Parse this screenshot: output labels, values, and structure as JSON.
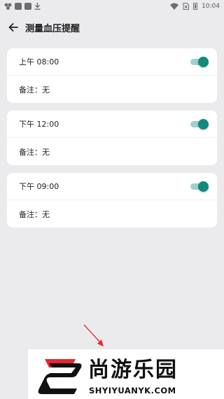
{
  "status_bar": {
    "time": "10:04",
    "icons": [
      "notification-dots-icon",
      "app-square-icon",
      "app-square-icon",
      "download-icon",
      "wifi-icon",
      "no-sim-icon",
      "battery-icon"
    ]
  },
  "app_bar": {
    "title": "测量血压提醒",
    "back_icon": "arrow-left-icon"
  },
  "reminders": [
    {
      "time_label": "上午 08:00",
      "note": "备注：无",
      "enabled": true
    },
    {
      "time_label": "下午 12:00",
      "note": "备注：无",
      "enabled": true
    },
    {
      "time_label": "下午 09:00",
      "note": "备注：无",
      "enabled": true
    }
  ],
  "colors": {
    "background": "#ebebee",
    "card": "#ffffff",
    "toggle_on": "#128a7d",
    "toggle_track": "#9fd2cb",
    "watermark_red": "#e8262b"
  },
  "watermark": {
    "brand_cn": "尚游乐园",
    "brand_en": "SHYIYUANYK.COM"
  }
}
